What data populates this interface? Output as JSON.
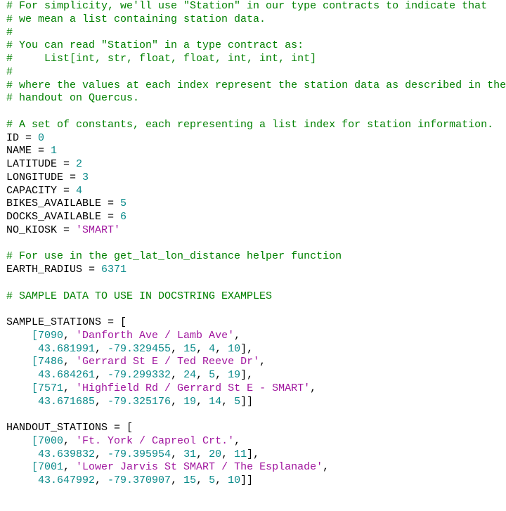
{
  "colors": {
    "comment": "#008000",
    "number": "#098a8a",
    "string": "#a0159e",
    "plain": "#000000"
  },
  "code_lines": [
    [
      {
        "c": "c",
        "t": "# For simplicity, we'll use \"Station\" in our type contracts to indicate that"
      }
    ],
    [
      {
        "c": "c",
        "t": "# we mean a list containing station data."
      }
    ],
    [
      {
        "c": "c",
        "t": "#"
      }
    ],
    [
      {
        "c": "c",
        "t": "# You can read \"Station\" in a type contract as:"
      }
    ],
    [
      {
        "c": "c",
        "t": "#     List[int, str, float, float, int, int, int]"
      }
    ],
    [
      {
        "c": "c",
        "t": "#"
      }
    ],
    [
      {
        "c": "c",
        "t": "# where the values at each index represent the station data as described in the"
      }
    ],
    [
      {
        "c": "c",
        "t": "# handout on Quercus."
      }
    ],
    [],
    [
      {
        "c": "c",
        "t": "# A set of constants, each representing a list index for station information."
      }
    ],
    [
      {
        "c": "p",
        "t": "ID = "
      },
      {
        "c": "n",
        "t": "0"
      }
    ],
    [
      {
        "c": "p",
        "t": "NAME = "
      },
      {
        "c": "n",
        "t": "1"
      }
    ],
    [
      {
        "c": "p",
        "t": "LATITUDE = "
      },
      {
        "c": "n",
        "t": "2"
      }
    ],
    [
      {
        "c": "p",
        "t": "LONGITUDE = "
      },
      {
        "c": "n",
        "t": "3"
      }
    ],
    [
      {
        "c": "p",
        "t": "CAPACITY = "
      },
      {
        "c": "n",
        "t": "4"
      }
    ],
    [
      {
        "c": "p",
        "t": "BIKES_AVAILABLE = "
      },
      {
        "c": "n",
        "t": "5"
      }
    ],
    [
      {
        "c": "p",
        "t": "DOCKS_AVAILABLE = "
      },
      {
        "c": "n",
        "t": "6"
      }
    ],
    [
      {
        "c": "p",
        "t": "NO_KIOSK = "
      },
      {
        "c": "s",
        "t": "'SMART'"
      }
    ],
    [],
    [
      {
        "c": "c",
        "t": "# For use in the get_lat_lon_distance helper function"
      }
    ],
    [
      {
        "c": "p",
        "t": "EARTH_RADIUS = "
      },
      {
        "c": "n",
        "t": "6371"
      }
    ],
    [],
    [
      {
        "c": "c",
        "t": "# SAMPLE DATA TO USE IN DOCSTRING EXAMPLES"
      }
    ],
    [],
    [
      {
        "c": "p",
        "t": "SAMPLE_STATIONS = ["
      }
    ],
    [
      {
        "c": "n",
        "t": "    [7090"
      },
      {
        "c": "p",
        "t": ", "
      },
      {
        "c": "s",
        "t": "'Danforth Ave / Lamb Ave'"
      },
      {
        "c": "p",
        "t": ","
      }
    ],
    [
      {
        "c": "n",
        "t": "     43.681991"
      },
      {
        "c": "p",
        "t": ", "
      },
      {
        "c": "n",
        "t": "-79.329455"
      },
      {
        "c": "p",
        "t": ", "
      },
      {
        "c": "n",
        "t": "15"
      },
      {
        "c": "p",
        "t": ", "
      },
      {
        "c": "n",
        "t": "4"
      },
      {
        "c": "p",
        "t": ", "
      },
      {
        "c": "n",
        "t": "10"
      },
      {
        "c": "p",
        "t": "],"
      }
    ],
    [
      {
        "c": "n",
        "t": "    [7486"
      },
      {
        "c": "p",
        "t": ", "
      },
      {
        "c": "s",
        "t": "'Gerrard St E / Ted Reeve Dr'"
      },
      {
        "c": "p",
        "t": ","
      }
    ],
    [
      {
        "c": "n",
        "t": "     43.684261"
      },
      {
        "c": "p",
        "t": ", "
      },
      {
        "c": "n",
        "t": "-79.299332"
      },
      {
        "c": "p",
        "t": ", "
      },
      {
        "c": "n",
        "t": "24"
      },
      {
        "c": "p",
        "t": ", "
      },
      {
        "c": "n",
        "t": "5"
      },
      {
        "c": "p",
        "t": ", "
      },
      {
        "c": "n",
        "t": "19"
      },
      {
        "c": "p",
        "t": "],"
      }
    ],
    [
      {
        "c": "n",
        "t": "    [7571"
      },
      {
        "c": "p",
        "t": ", "
      },
      {
        "c": "s",
        "t": "'Highfield Rd / Gerrard St E - SMART'"
      },
      {
        "c": "p",
        "t": ","
      }
    ],
    [
      {
        "c": "n",
        "t": "     43.671685"
      },
      {
        "c": "p",
        "t": ", "
      },
      {
        "c": "n",
        "t": "-79.325176"
      },
      {
        "c": "p",
        "t": ", "
      },
      {
        "c": "n",
        "t": "19"
      },
      {
        "c": "p",
        "t": ", "
      },
      {
        "c": "n",
        "t": "14"
      },
      {
        "c": "p",
        "t": ", "
      },
      {
        "c": "n",
        "t": "5"
      },
      {
        "c": "p",
        "t": "]]"
      }
    ],
    [],
    [
      {
        "c": "p",
        "t": "HANDOUT_STATIONS = ["
      }
    ],
    [
      {
        "c": "n",
        "t": "    [7000"
      },
      {
        "c": "p",
        "t": ", "
      },
      {
        "c": "s",
        "t": "'Ft. York / Capreol Crt.'"
      },
      {
        "c": "p",
        "t": ","
      }
    ],
    [
      {
        "c": "n",
        "t": "     43.639832"
      },
      {
        "c": "p",
        "t": ", "
      },
      {
        "c": "n",
        "t": "-79.395954"
      },
      {
        "c": "p",
        "t": ", "
      },
      {
        "c": "n",
        "t": "31"
      },
      {
        "c": "p",
        "t": ", "
      },
      {
        "c": "n",
        "t": "20"
      },
      {
        "c": "p",
        "t": ", "
      },
      {
        "c": "n",
        "t": "11"
      },
      {
        "c": "p",
        "t": "],"
      }
    ],
    [
      {
        "c": "n",
        "t": "    [7001"
      },
      {
        "c": "p",
        "t": ", "
      },
      {
        "c": "s",
        "t": "'Lower Jarvis St SMART / The Esplanade'"
      },
      {
        "c": "p",
        "t": ","
      }
    ],
    [
      {
        "c": "n",
        "t": "     43.647992"
      },
      {
        "c": "p",
        "t": ", "
      },
      {
        "c": "n",
        "t": "-79.370907"
      },
      {
        "c": "p",
        "t": ", "
      },
      {
        "c": "n",
        "t": "15"
      },
      {
        "c": "p",
        "t": ", "
      },
      {
        "c": "n",
        "t": "5"
      },
      {
        "c": "p",
        "t": ", "
      },
      {
        "c": "n",
        "t": "10"
      },
      {
        "c": "p",
        "t": "]]"
      }
    ]
  ]
}
